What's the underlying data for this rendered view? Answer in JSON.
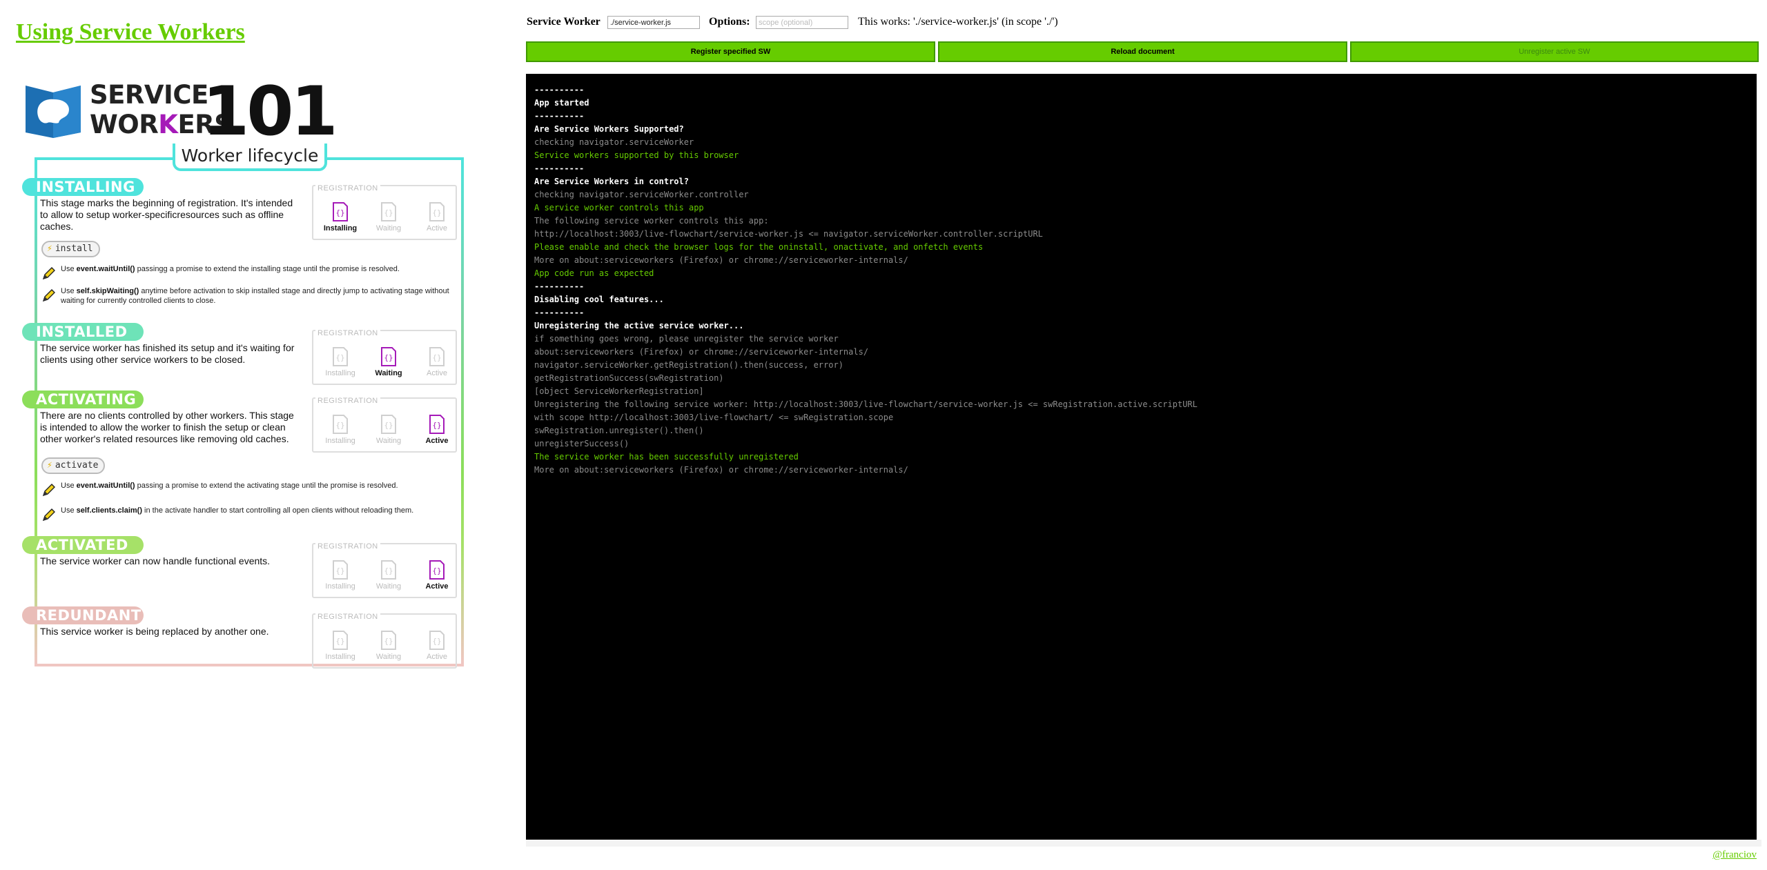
{
  "page": {
    "title_link": "Using Service Workers",
    "author_link": "@franciov"
  },
  "banner": {
    "service": "SERVICE",
    "workers_pre": "WOR",
    "workers_k": "K",
    "workers_post": "ERS",
    "number": "101",
    "lifecycle_title": "Worker lifecycle"
  },
  "registration": {
    "label": "REGISTRATION",
    "slots": [
      "Installing",
      "Waiting",
      "Active"
    ]
  },
  "stages": [
    {
      "name": "INSTALLING",
      "color": "#4fe3dc",
      "text": "This stage marks the beginning of registration. It's intended to allow to setup worker-specificresources such as offline caches.",
      "event": "install",
      "active_slot": "Installing",
      "tips": [
        {
          "bold": "event.waitUntil()",
          "text": " passingg a promise to extend the installing stage until the promise is resolved."
        },
        {
          "bold": "self.skipWaiting()",
          "text": " anytime before activation to skip installed stage and directly jump to activating stage without waiting for currently controlled clients to close."
        }
      ]
    },
    {
      "name": "INSTALLED",
      "color": "#6ee3b8",
      "text": "The service worker has finished its setup and it's waiting for clients using other service workers to be closed.",
      "active_slot": "Waiting"
    },
    {
      "name": "ACTIVATING",
      "color": "#8cde5a",
      "text": "There are no clients controlled by other workers. This stage is intended to allow the worker to finish the setup or clean other worker's related resources like removing old caches.",
      "event": "activate",
      "active_slot": "Active",
      "tips": [
        {
          "bold": "event.waitUntil()",
          "text": " passing a promise to extend the activating stage until the promise is resolved."
        },
        {
          "bold": "self.clients.claim()",
          "text": "  in the activate handler to start controlling all open clients without reloading them."
        }
      ]
    },
    {
      "name": "ACTIVATED",
      "color": "#a6e168",
      "text": "The service worker can now handle functional events.",
      "active_slot": "Active"
    },
    {
      "name": "REDUNDANT",
      "color": "#e9bdb8",
      "text": "This service worker is being replaced by another one.",
      "active_slot": ""
    }
  ],
  "tip_prefix": "Use",
  "controls": {
    "sw_label": "Service Worker",
    "sw_value": "./service-worker.js",
    "options_label": "Options:",
    "scope_placeholder": "scope (optional)",
    "works_text": "This works: './service-worker.js' (in scope './')",
    "register_btn": "Register specified SW",
    "reload_btn": "Reload document",
    "unregister_btn": "Unregister active SW"
  },
  "colors": {
    "accent": "#66cc00",
    "console_bg": "#000000",
    "console_header": "#ffffff",
    "console_gray": "#8c8c8c",
    "console_green": "#66cc00",
    "active_icon": "#a51ab8"
  },
  "console": [
    {
      "t": "----------",
      "c": "h"
    },
    {
      "t": "App started",
      "c": "h"
    },
    {
      "t": "----------",
      "c": "h"
    },
    {
      "t": "Are Service Workers Supported?",
      "c": "h"
    },
    {
      "t": "checking navigator.serviceWorker",
      "c": "g"
    },
    {
      "t": "Service workers supported by this browser",
      "c": "gr"
    },
    {
      "t": "----------",
      "c": "h"
    },
    {
      "t": "Are Service Workers in control?",
      "c": "h"
    },
    {
      "t": "checking navigator.serviceWorker.controller",
      "c": "g"
    },
    {
      "t": "A service worker controls this app",
      "c": "gr"
    },
    {
      "t": "The following service worker controls this app:",
      "c": "g"
    },
    {
      "t": "http://localhost:3003/live-flowchart/service-worker.js <= navigator.serviceWorker.controller.scriptURL",
      "c": "g"
    },
    {
      "t": "Please enable and check the browser logs for the oninstall, onactivate, and onfetch events",
      "c": "gr"
    },
    {
      "t": "More on about:serviceworkers (Firefox) or chrome://serviceworker-internals/",
      "c": "g"
    },
    {
      "t": "App code run as expected",
      "c": "gr"
    },
    {
      "t": "----------",
      "c": "h"
    },
    {
      "t": "Disabling cool features...",
      "c": "h"
    },
    {
      "t": "----------",
      "c": "h"
    },
    {
      "t": "Unregistering the active service worker...",
      "c": "h"
    },
    {
      "t": "if something goes wrong, please unregister the service worker",
      "c": "g"
    },
    {
      "t": "about:serviceworkers (Firefox) or chrome://serviceworker-internals/",
      "c": "g"
    },
    {
      "t": "navigator.serviceWorker.getRegistration().then(success, error)",
      "c": "g"
    },
    {
      "t": "getRegistrationSuccess(swRegistration)",
      "c": "g"
    },
    {
      "t": "[object ServiceWorkerRegistration]",
      "c": "g"
    },
    {
      "t": "Unregistering the following service worker: http://localhost:3003/live-flowchart/service-worker.js <= swRegistration.active.scriptURL",
      "c": "g"
    },
    {
      "t": "with scope http://localhost:3003/live-flowchart/ <= swRegistration.scope",
      "c": "g"
    },
    {
      "t": "swRegistration.unregister().then()",
      "c": "g"
    },
    {
      "t": "unregisterSuccess()",
      "c": "g"
    },
    {
      "t": "The service worker has been successfully unregistered",
      "c": "gr"
    },
    {
      "t": "More on about:serviceworkers (Firefox) or chrome://serviceworker-internals/",
      "c": "g"
    }
  ]
}
